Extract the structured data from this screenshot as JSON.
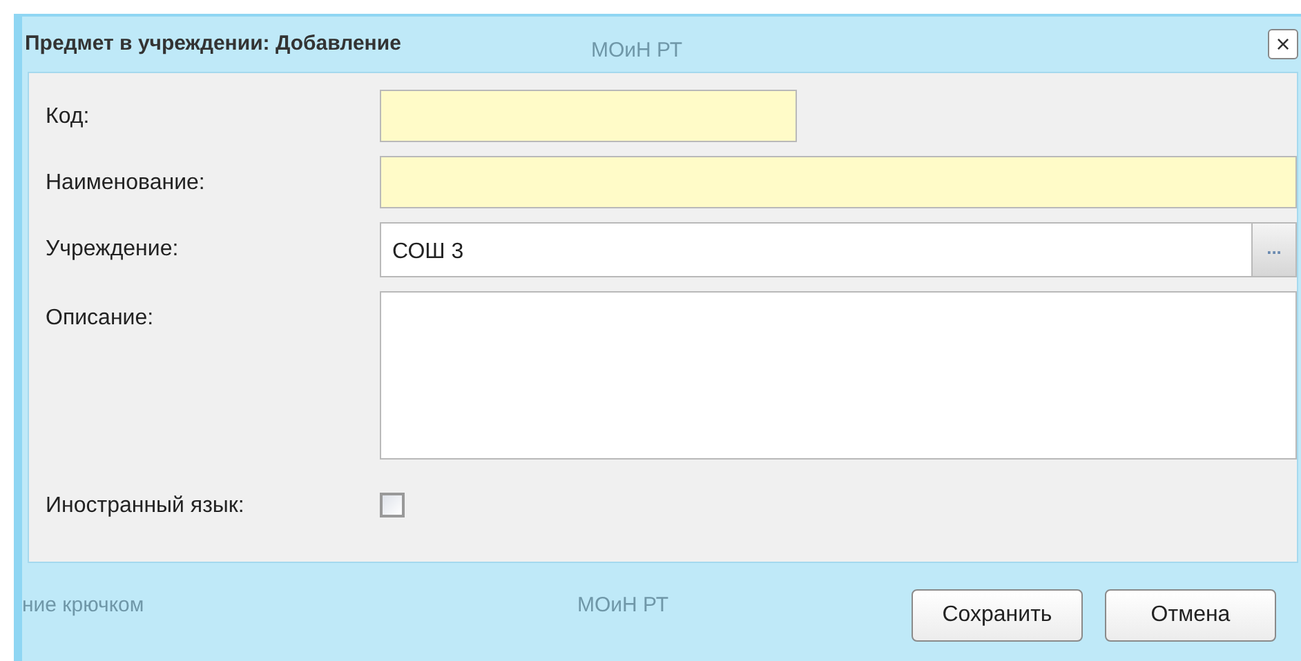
{
  "window": {
    "title": "Предмет в учреждении: Добавление",
    "close": "×"
  },
  "background_texts": [
    "МОиН РТ",
    "ние крючком",
    "МОиН РТ"
  ],
  "fields": [
    {
      "kind": "short_text",
      "label": "Код:",
      "required": true
    },
    {
      "kind": "text",
      "label": "Наименование:",
      "required": true
    },
    {
      "kind": "select",
      "label": "Учреждение:",
      "value": "СОШ 3",
      "required": false,
      "button": "..."
    },
    {
      "kind": "textarea",
      "label": "Описание:",
      "required": false
    },
    {
      "kind": "checkbox",
      "label": "Иностранный язык:",
      "checked": false
    }
  ],
  "buttons": [
    "Сохранить",
    "Отмена"
  ]
}
